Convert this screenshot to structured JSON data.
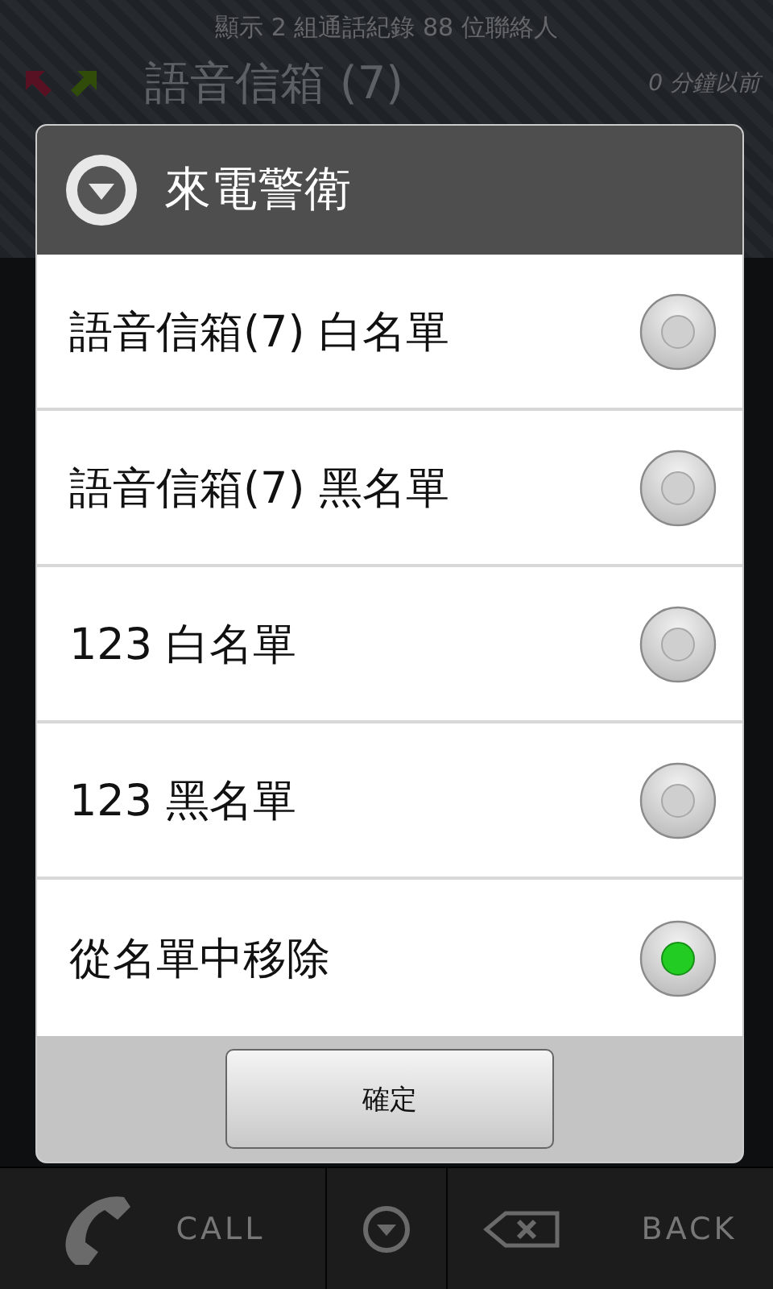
{
  "header": {
    "summary": "顯示 2 組通話紀錄 88 位聯絡人",
    "entry_name": "語音信箱 (7)",
    "entry_time": "0 分鐘以前"
  },
  "dialog": {
    "title": "來電警衛",
    "options": [
      {
        "label": "語音信箱(7) 白名單",
        "selected": false
      },
      {
        "label": "語音信箱(7) 黑名單",
        "selected": false
      },
      {
        "label": "123 白名單",
        "selected": false
      },
      {
        "label": "123 黑名單",
        "selected": false
      },
      {
        "label": "從名單中移除",
        "selected": true
      }
    ],
    "confirm": "確定"
  },
  "bottom_bar": {
    "call": "CALL",
    "back": "BACK"
  }
}
